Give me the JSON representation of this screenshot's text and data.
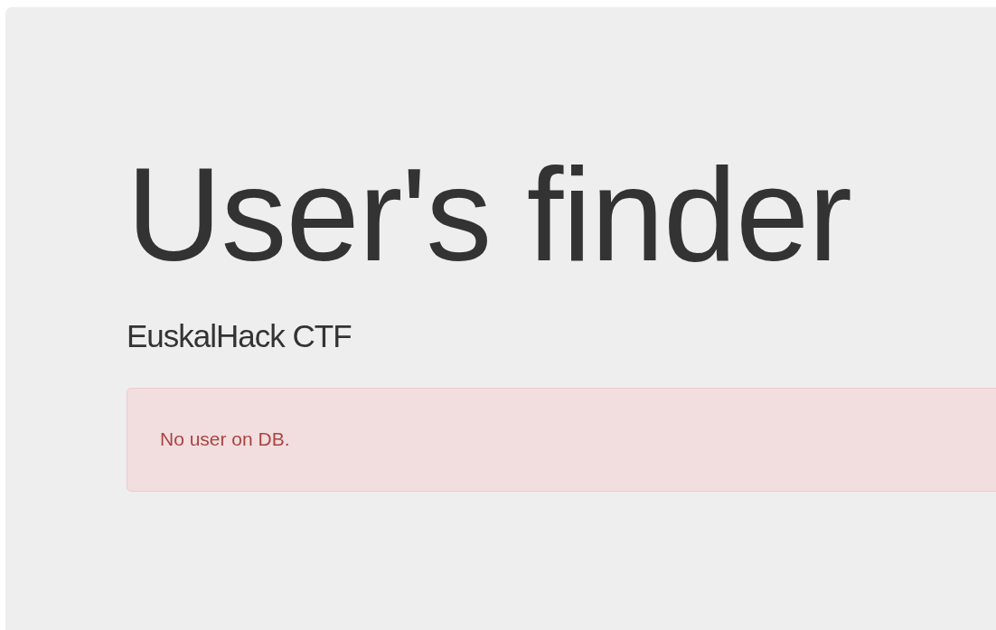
{
  "title": "User's finder",
  "subtitle": "EuskalHack CTF",
  "alert": {
    "kind": "danger",
    "message": "No user on DB."
  }
}
